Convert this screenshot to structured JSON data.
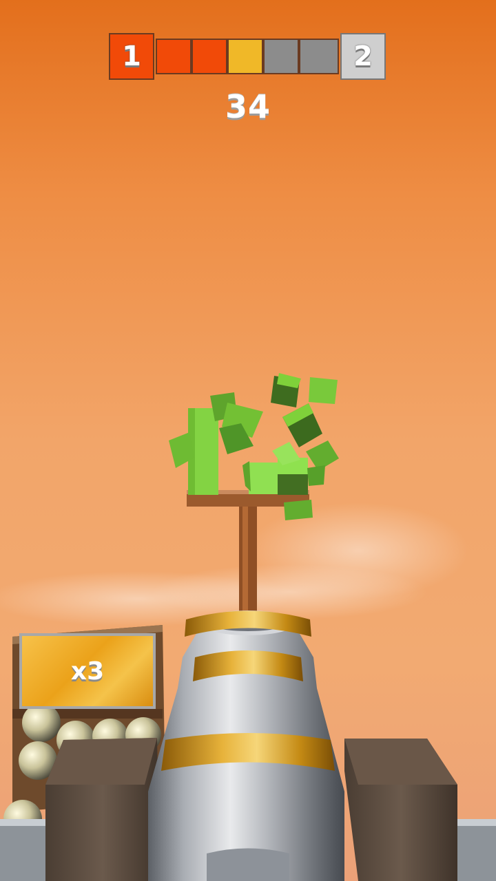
{
  "hud": {
    "current_level": "1",
    "next_level": "2",
    "stage_progress": {
      "segments": [
        "#f14a08",
        "#f14a08",
        "#f0b828",
        "#8c8c8c",
        "#8c8c8c"
      ],
      "completed": 2,
      "current": 1,
      "total": 5
    },
    "score": "34"
  },
  "ammo": {
    "multiplier_label": "x3"
  },
  "colors": {
    "sky_top": "#e36f1c",
    "sky_bottom": "#eba178",
    "block_green": "#7fd13a",
    "cannon_steel": "#bfc4c9",
    "cannon_band": "#d9a21c",
    "stand_wood": "#9b5a2d"
  }
}
